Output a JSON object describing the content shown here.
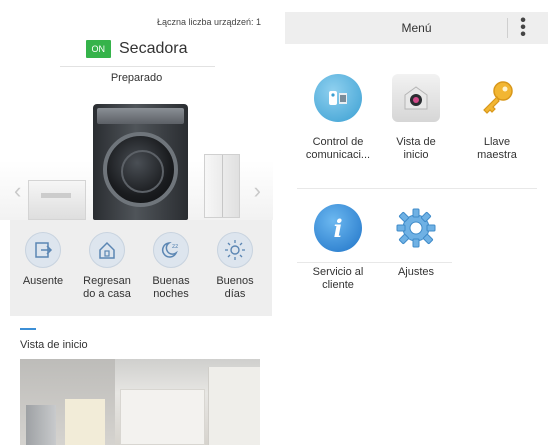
{
  "left_panel": {
    "device_count": "Łączna liczba urządzeń: 1",
    "on_badge": "ON",
    "device_name": "Secadora",
    "device_state": "Preparado",
    "carousel_prev": "‹",
    "carousel_next": "›",
    "modes": [
      {
        "label_line1": "Ausente",
        "label_line2": "",
        "icon": "away-icon"
      },
      {
        "label_line1": "Regresan",
        "label_line2": "do a casa",
        "icon": "home-icon"
      },
      {
        "label_line1": "Buenas",
        "label_line2": "noches",
        "icon": "sleep-icon"
      },
      {
        "label_line1": "Buenos",
        "label_line2": "días",
        "icon": "sun-icon"
      }
    ],
    "section_title": "Vista de inicio"
  },
  "right_panel": {
    "menu_title": "Menú",
    "items": [
      {
        "label_line1": "Control de",
        "label_line2": "comunicaci...",
        "icon": "remote-control-icon"
      },
      {
        "label_line1": "Vista de",
        "label_line2": "inicio",
        "icon": "home-view-icon"
      },
      {
        "label_line1": "Llave",
        "label_line2": "maestra",
        "icon": "key-icon"
      },
      {
        "label_line1": "Servicio al",
        "label_line2": "cliente",
        "icon": "info-icon"
      },
      {
        "label_line1": "Ajustes",
        "label_line2": "",
        "icon": "gear-icon"
      }
    ]
  },
  "colors": {
    "on_green": "#35b34a",
    "accent_blue": "#3c8fd6",
    "menu_bar": "#eeeeee",
    "key_yellow": "#f2b632"
  }
}
